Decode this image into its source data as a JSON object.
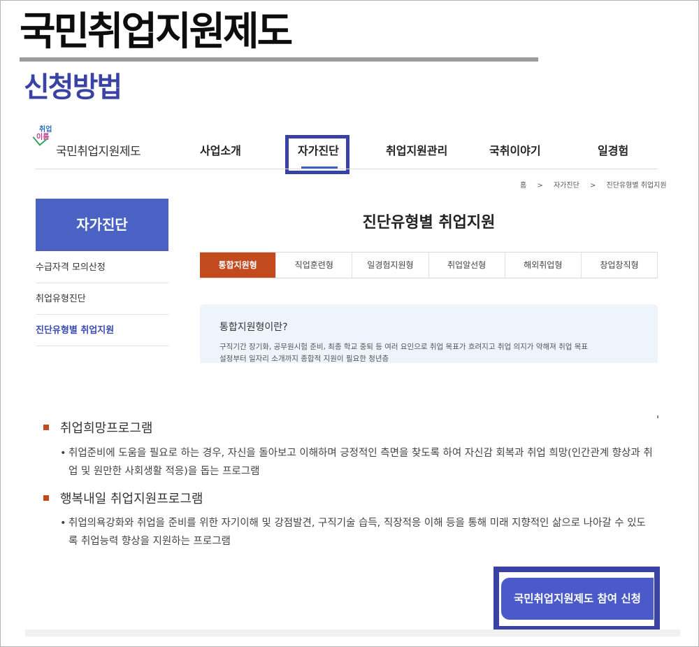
{
  "heading": "국민취업지원제도",
  "subheading": "신청방법",
  "site": {
    "logo": {
      "mark_top": "취업",
      "mark_bottom": "이름",
      "text": "국민취업지원제도"
    },
    "gnb": [
      "사업소개",
      "자가진단",
      "취업지원관리",
      "국취이야기",
      "일경험"
    ],
    "gnb_active": "자가진단",
    "breadcrumb": [
      "홈",
      ">",
      "자가진단",
      ">",
      "진단유형별 취업지원"
    ],
    "lnb": {
      "title": "자가진단",
      "items": [
        "수급자격 모의산정",
        "취업유형진단",
        "진단유형별 취업지원"
      ],
      "active_index": 2
    },
    "content_title": "진단유형별 취업지원",
    "tabs": [
      "통합지원형",
      "직업훈련형",
      "일경험지원형",
      "취업알선형",
      "해외취업형",
      "창업창직형"
    ],
    "active_tab": "통합지원형",
    "info": {
      "title": "통합지원형이란?",
      "desc_line1": "구직기간 장기화, 공무원시험 준비, 최종 학교 중퇴 등 여러 요인으로 취업 목표가 흐려지고 취업 의지가 약해져 취업 목표",
      "desc_line2": "설정부터 일자리 소개까지 종합적 지원이 필요한 청년층"
    }
  },
  "programs": [
    {
      "title": "취업희망프로그램",
      "bullet": "•",
      "desc": "취업준비에 도움을 필요로 하는 경우, 자신을 돌아보고 이해하며 긍정적인 측면을 찾도록 하여 자신감 회복과 취업 희망(인간관계 향상과 취업 및 원만한 사회생활 적응)을 돕는 프로그램"
    },
    {
      "title": "행복내일 취업지원프로그램",
      "bullet": "•",
      "desc": "취업의욕강화와 취업을 준비를 위한 자기이해 및 강점발견, 구직기술 습득, 직장적응 이해 등을 통해 미래 지향적인 삶으로 나아갈 수 있도록 취업능력 향상을 지원하는 프로그램"
    }
  ],
  "cta": {
    "label": "국민취업지원제도 참여 신청"
  },
  "colors": {
    "brand_blue": "#3a43a3",
    "tab_active": "#c24a1d",
    "lnb_title": "#4a62c4",
    "info_bg": "#eef4fb"
  }
}
